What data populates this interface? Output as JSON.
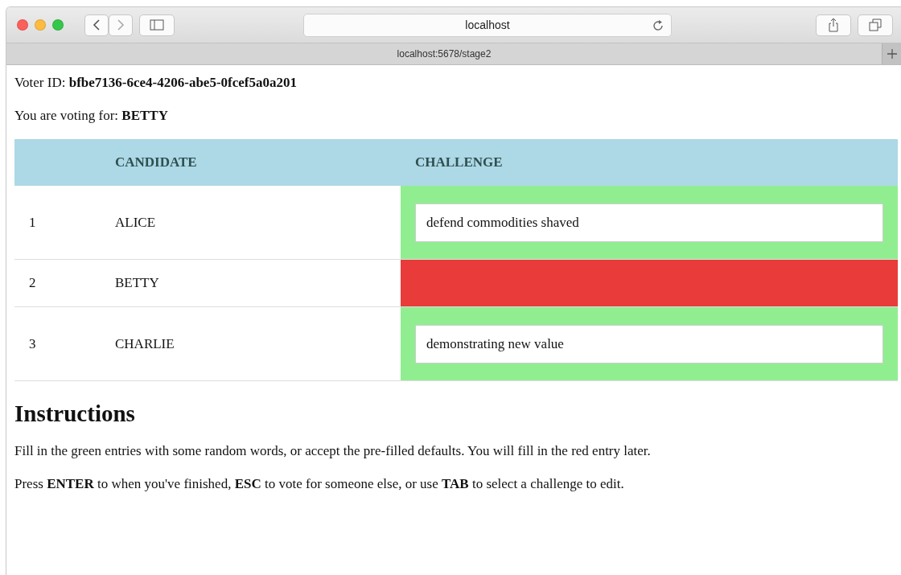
{
  "browser": {
    "address": "localhost",
    "tab_title": "localhost:5678/stage2"
  },
  "voter": {
    "label": "Voter ID:",
    "id": "bfbe7136-6ce4-4206-abe5-0fcef5a0a201"
  },
  "voting_for": {
    "label": "You are voting for:",
    "name": "BETTY"
  },
  "table": {
    "columns": [
      "CANDIDATE",
      "CHALLENGE"
    ],
    "rows": [
      {
        "number": "1",
        "candidate": "ALICE",
        "kind": "editable",
        "value": "defend commodities shaved"
      },
      {
        "number": "2",
        "candidate": "BETTY",
        "kind": "locked"
      },
      {
        "number": "3",
        "candidate": "CHARLIE",
        "kind": "editable",
        "value": "demonstrating new value"
      }
    ]
  },
  "instructions": {
    "heading": "Instructions",
    "paragraphs": [
      "Fill in the green entries with some random words, or accept the pre-filled defaults. You will fill in the red entry later.",
      "Press **ENTER** to when you've finished, **ESC** to vote for someone else, or use **TAB** to select a challenge to edit."
    ]
  }
}
